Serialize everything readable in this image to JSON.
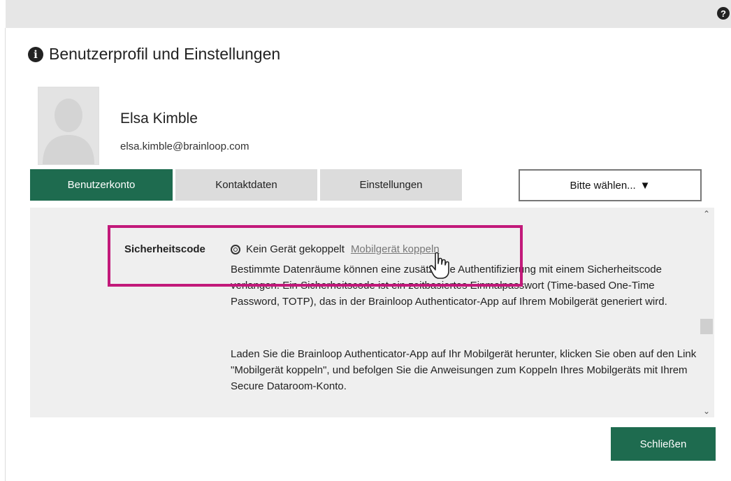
{
  "header": {
    "help_glyph": "?"
  },
  "dialog": {
    "title": "Benutzerprofil und Einstellungen",
    "info_glyph": "i"
  },
  "user": {
    "name": "Elsa Kimble",
    "email": "elsa.kimble@brainloop.com"
  },
  "tabs": [
    {
      "label": "Benutzerkonto",
      "active": true
    },
    {
      "label": "Kontaktdaten",
      "active": false
    },
    {
      "label": "Einstellungen",
      "active": false
    }
  ],
  "select": {
    "label": "Bitte wählen...",
    "arrow": "▼"
  },
  "security": {
    "label": "Sicherheitscode",
    "status": "Kein Gerät gekoppelt",
    "link": "Mobilgerät koppeln",
    "description1": "Bestimmte Datenräume können eine zusätzliche Authentifizierung mit einem Sicherheitscode verlangen. Ein Sicherheitscode ist ein zeitbasiertes Einmalpasswort (Time-based One-Time Password, TOTP), das in der Brainloop Authenticator-App auf Ihrem Mobilgerät generiert wird.",
    "description2": "Laden Sie die Brainloop Authenticator-App auf Ihr Mobilgerät herunter, klicken Sie oben auf den Link \"Mobilgerät koppeln\", und befolgen Sie die Anweisungen zum Koppeln Ihres Mobilgeräts mit Ihrem Secure Dataroom-Konto."
  },
  "scrollbar": {
    "up": "⌃",
    "down": "⌄"
  },
  "buttons": {
    "close": "Schließen"
  },
  "colors": {
    "accent": "#1e6b4f",
    "highlight": "#c2197a",
    "panel": "#efefef"
  },
  "icons": [
    "help-icon",
    "info-icon",
    "radio-icon",
    "hand-cursor-icon"
  ]
}
